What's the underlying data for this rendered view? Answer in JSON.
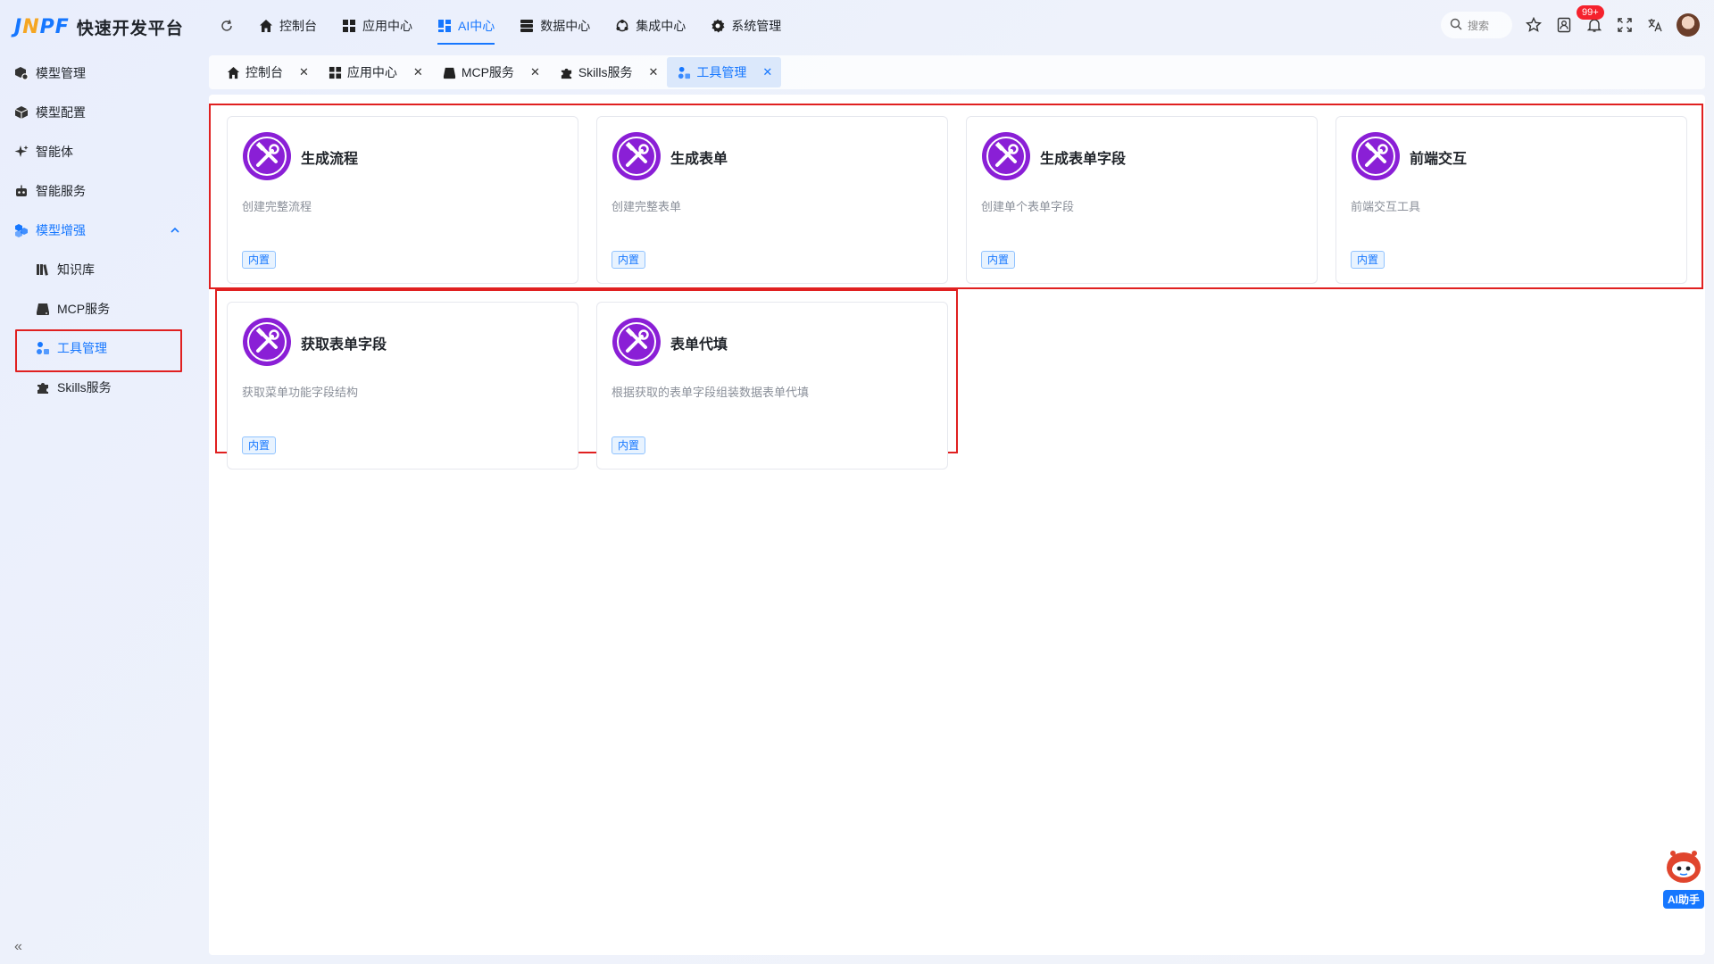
{
  "brand": {
    "logo_mark_a": "J",
    "logo_mark_b": "N",
    "logo_mark_c": "PF",
    "title": "快速开发平台"
  },
  "sidebar": {
    "items": [
      {
        "label": "模型管理",
        "icon": "cube-gear-icon"
      },
      {
        "label": "模型配置",
        "icon": "cube-icon"
      },
      {
        "label": "智能体",
        "icon": "sparkle-icon"
      },
      {
        "label": "智能服务",
        "icon": "robot-icon"
      },
      {
        "label": "模型增强",
        "icon": "cubes-icon",
        "expanded": true
      },
      {
        "label": "知识库",
        "icon": "books-icon"
      },
      {
        "label": "MCP服务",
        "icon": "server-icon"
      },
      {
        "label": "工具管理",
        "icon": "tools-icon",
        "active": true
      },
      {
        "label": "Skills服务",
        "icon": "puzzle-icon"
      }
    ],
    "collapse_label": "«"
  },
  "topnav": {
    "items": [
      {
        "label": "控制台",
        "icon": "home-icon"
      },
      {
        "label": "应用中心",
        "icon": "grid-icon"
      },
      {
        "label": "AI中心",
        "icon": "ai-grid-icon",
        "active": true
      },
      {
        "label": "数据中心",
        "icon": "database-icon"
      },
      {
        "label": "集成中心",
        "icon": "integration-icon"
      },
      {
        "label": "系统管理",
        "icon": "gear-icon"
      }
    ],
    "search_placeholder": "搜索",
    "notification_badge": "99+"
  },
  "tabs": [
    {
      "label": "控制台",
      "icon": "home-icon"
    },
    {
      "label": "应用中心",
      "icon": "grid-icon"
    },
    {
      "label": "MCP服务",
      "icon": "server-icon"
    },
    {
      "label": "Skills服务",
      "icon": "puzzle-icon"
    },
    {
      "label": "工具管理",
      "icon": "tools-icon",
      "active": true
    }
  ],
  "tools": [
    {
      "title": "生成流程",
      "desc": "创建完整流程",
      "tag": "内置"
    },
    {
      "title": "生成表单",
      "desc": "创建完整表单",
      "tag": "内置"
    },
    {
      "title": "生成表单字段",
      "desc": "创建单个表单字段",
      "tag": "内置"
    },
    {
      "title": "前端交互",
      "desc": "前端交互工具",
      "tag": "内置"
    },
    {
      "title": "获取表单字段",
      "desc": "获取菜单功能字段结构",
      "tag": "内置"
    },
    {
      "title": "表单代填",
      "desc": "根据获取的表单字段组装数据表单代填",
      "tag": "内置"
    }
  ],
  "ai_helper": {
    "label": "AI助手"
  },
  "colors": {
    "accent": "#1677ff",
    "highlight_box": "#e02020",
    "tool_icon": "#8a1fd6"
  }
}
